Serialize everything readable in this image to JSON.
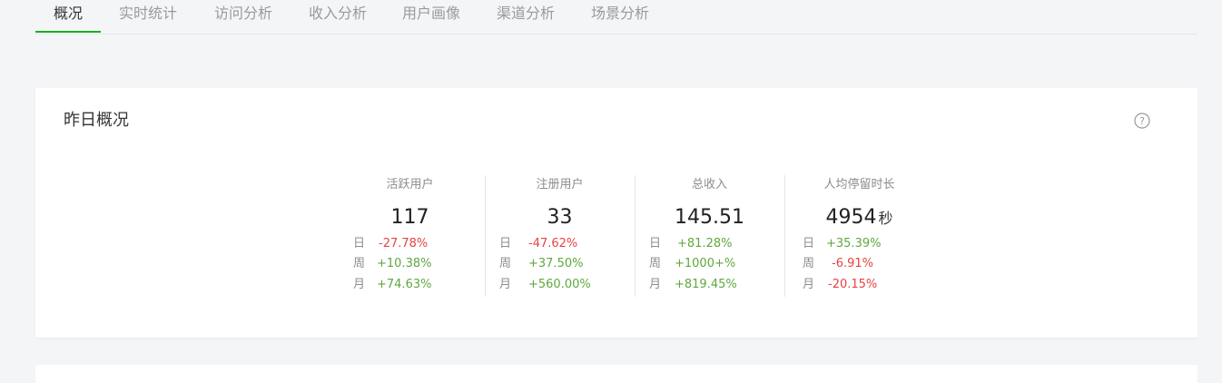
{
  "tabs": [
    {
      "label": "概况",
      "active": true
    },
    {
      "label": "实时统计",
      "active": false
    },
    {
      "label": "访问分析",
      "active": false
    },
    {
      "label": "收入分析",
      "active": false
    },
    {
      "label": "用户画像",
      "active": false
    },
    {
      "label": "渠道分析",
      "active": false
    },
    {
      "label": "场景分析",
      "active": false
    }
  ],
  "card": {
    "title": "昨日概况",
    "help_icon": "question-circle-icon",
    "stats": [
      {
        "label": "活跃用户",
        "value": "117",
        "unit": "",
        "day_key": "日",
        "day": "-27.78%",
        "week_key": "周",
        "week": "+10.38%",
        "month_key": "月",
        "month": "+74.63%"
      },
      {
        "label": "注册用户",
        "value": "33",
        "unit": "",
        "day_key": "日",
        "day": "-47.62%",
        "week_key": "周",
        "week": "+37.50%",
        "month_key": "月",
        "month": "+560.00%"
      },
      {
        "label": "总收入",
        "value": "145.51",
        "unit": "",
        "day_key": "日",
        "day": "+81.28%",
        "week_key": "周",
        "week": "+1000+%",
        "month_key": "月",
        "month": "+819.45%"
      },
      {
        "label": "人均停留时长",
        "value": "4954",
        "unit": "秒",
        "day_key": "日",
        "day": "+35.39%",
        "week_key": "周",
        "week": "-6.91%",
        "month_key": "月",
        "month": "-20.15%"
      }
    ]
  },
  "colors": {
    "accent": "#1aad19",
    "negative": "#e64340",
    "positive": "#5fa83f",
    "background": "#f4f5f7"
  }
}
